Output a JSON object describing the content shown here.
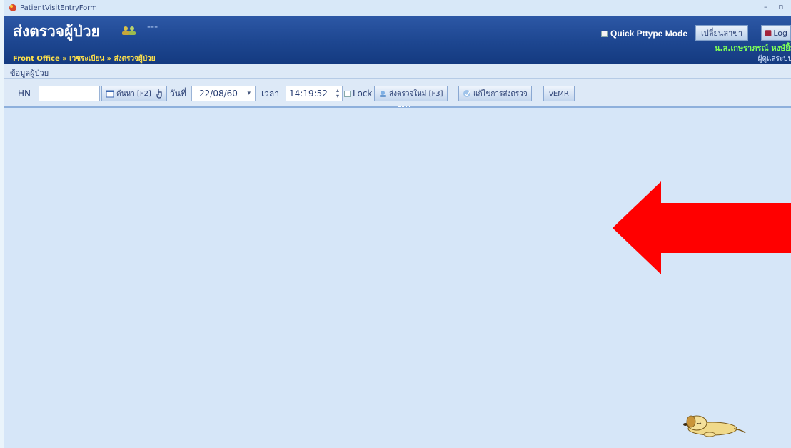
{
  "window": {
    "title": "PatientVisitEntryForm"
  },
  "header": {
    "page_title": "ส่งตรวจผู้ป่วย",
    "dots": "---",
    "breadcrumb": "Front Office » เวชระเบียน » ส่งตรวจผู้ป่วย",
    "quick_mode_label": "Quick Pttype Mode",
    "change_branch_label": "เปลี่ยนสาขา",
    "logout_label": "Log",
    "user_name": "น.ส.เกษราภรณ์ หงษ์ยิ้ม",
    "user_role": "ผู้ดูแลระบบ"
  },
  "section": {
    "label": "ข้อมูลผู้ป่วย"
  },
  "toolbar": {
    "hn_label": "HN",
    "hn_value": "",
    "search_label": "ค้นหา [F2]",
    "date_label": "วันที่",
    "date_value": "22/08/60",
    "time_label": "เวลา",
    "time_value": "14:19:52",
    "lock_label": "Lock",
    "new_visit_label": "ส่งตรวจใหม่ [F3]",
    "edit_visit_label": "แก้ไขการส่งตรวจ",
    "vemr_label": "vEMR"
  },
  "colors": {
    "header_bg": "#1d4690",
    "breadcrumb": "#ffe14a",
    "user_name": "#7dff57",
    "main_bg": "#d6e6f8",
    "arrow": "#ff0000"
  },
  "icons": [
    "app-icon",
    "users-icon",
    "calendar-icon",
    "pointer-icon",
    "new-visit-icon",
    "edit-visit-icon",
    "logout-icon",
    "sleeping-dog-icon",
    "red-arrow"
  ]
}
